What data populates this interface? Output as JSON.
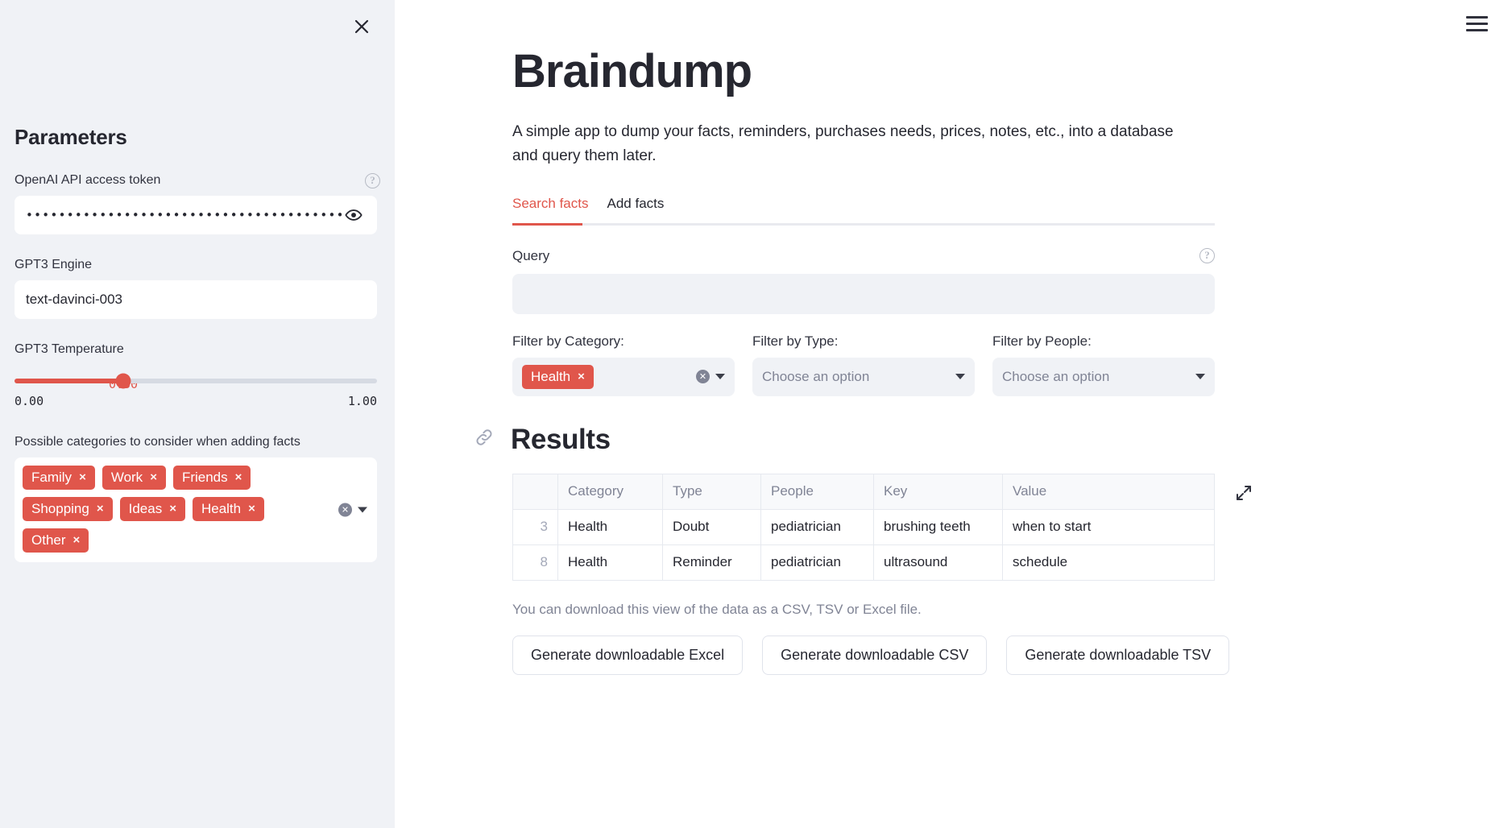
{
  "sidebar": {
    "close_icon": "close-icon",
    "title": "Parameters",
    "token": {
      "label": "OpenAI API access token",
      "help_icon": "help-circle-icon",
      "masked_value": "••••••••••••••••••••••••••••••••••••••••••••••••••",
      "reveal_icon": "eye-icon"
    },
    "engine": {
      "label": "GPT3 Engine",
      "value": "text-davinci-003"
    },
    "temperature": {
      "label": "GPT3 Temperature",
      "value": "0.30",
      "value_number": 0.3,
      "min_label": "0.00",
      "max_label": "1.00",
      "min": 0.0,
      "max": 1.0,
      "accent": "#e0564b"
    },
    "categories": {
      "label": "Possible categories to consider when adding facts",
      "tags": [
        "Family",
        "Work",
        "Friends",
        "Shopping",
        "Ideas",
        "Health",
        "Other"
      ],
      "remove_glyph": "×",
      "clear_icon": "clear-all-icon",
      "dropdown_icon": "chevron-down-icon"
    }
  },
  "header": {
    "menu_icon": "hamburger-menu-icon"
  },
  "main": {
    "title": "Braindump",
    "description": "A simple app to dump your facts, reminders, purchases needs, prices, notes, etc., into a database and query them later.",
    "tabs": [
      {
        "label": "Search facts",
        "active": true
      },
      {
        "label": "Add facts",
        "active": false
      }
    ],
    "query": {
      "label": "Query",
      "help_icon": "help-circle-icon",
      "value": "",
      "placeholder": ""
    },
    "filters": [
      {
        "label": "Filter by Category:",
        "selected": [
          "Health"
        ],
        "placeholder": "",
        "clear_icon": "clear-all-icon",
        "dropdown_icon": "chevron-down-icon"
      },
      {
        "label": "Filter by Type:",
        "selected": [],
        "placeholder": "Choose an option",
        "dropdown_icon": "chevron-down-icon"
      },
      {
        "label": "Filter by People:",
        "selected": [],
        "placeholder": "Choose an option",
        "dropdown_icon": "chevron-down-icon"
      }
    ],
    "results": {
      "anchor_icon": "link-icon",
      "title": "Results",
      "expand_icon": "expand-fullscreen-icon",
      "columns": [
        "",
        "Category",
        "Type",
        "People",
        "Key",
        "Value"
      ],
      "rows": [
        {
          "index": "3",
          "category": "Health",
          "type": "Doubt",
          "people": "pediatrician",
          "key": "brushing teeth",
          "value": "when to start"
        },
        {
          "index": "8",
          "category": "Health",
          "type": "Reminder",
          "people": "pediatrician",
          "key": "ultrasound",
          "value": "schedule"
        }
      ]
    },
    "download": {
      "note": "You can download this view of the data as a CSV, TSV or Excel file.",
      "buttons": [
        "Generate downloadable Excel",
        "Generate downloadable CSV",
        "Generate downloadable TSV"
      ]
    }
  },
  "colors": {
    "accent": "#e0564b",
    "sidebar_bg": "#f0f2f6",
    "text": "#262730",
    "muted": "#808495"
  }
}
